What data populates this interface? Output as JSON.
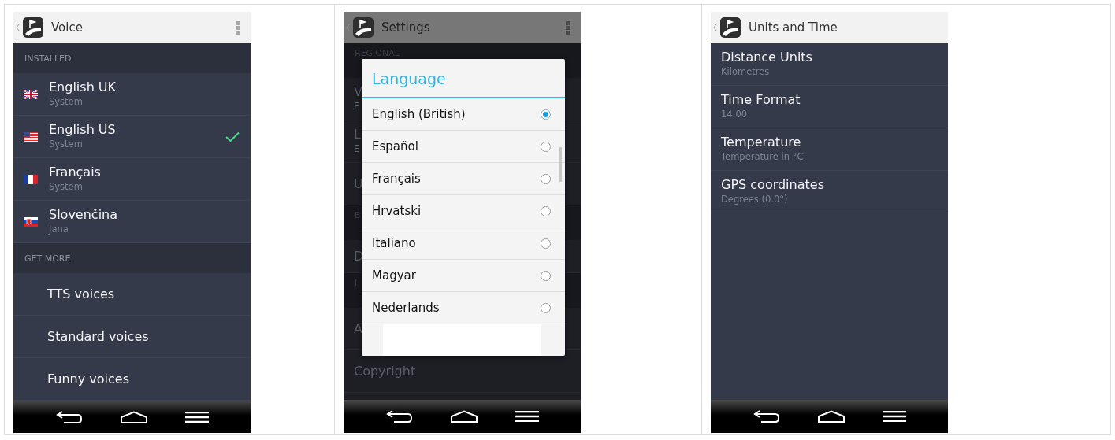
{
  "screens": [
    {
      "kind": "voice",
      "title": "Voice",
      "menu": true,
      "sections": [
        {
          "label": "INSTALLED",
          "items": [
            {
              "kind": "uk",
              "title": "English UK",
              "subtitle": "System",
              "selected": false
            },
            {
              "kind": "us",
              "title": "English US",
              "subtitle": "System",
              "selected": true
            },
            {
              "kind": "fr",
              "title": "Français",
              "subtitle": "System",
              "selected": false
            },
            {
              "kind": "sk",
              "title": "Slovenčina",
              "subtitle": "Jana",
              "selected": false
            }
          ]
        },
        {
          "label": "GET MORE",
          "items": [
            {
              "kind": "link",
              "title": "TTS voices"
            },
            {
              "kind": "link",
              "title": "Standard voices"
            },
            {
              "kind": "link",
              "title": "Funny voices"
            }
          ]
        }
      ]
    },
    {
      "kind": "dialog",
      "title": "Settings",
      "menu": true,
      "background": [
        {
          "kind": "section",
          "texts": [
            "REGIONAL"
          ]
        },
        {
          "kind": "item",
          "texts": [
            "V",
            "E"
          ]
        },
        {
          "kind": "item",
          "texts": [
            "L",
            "E"
          ]
        },
        {
          "kind": "item",
          "texts": [
            "U"
          ]
        },
        {
          "kind": "section",
          "texts": [
            "B"
          ]
        },
        {
          "kind": "short",
          "texts": [
            "D"
          ]
        },
        {
          "kind": "section",
          "texts": [
            "I"
          ]
        },
        {
          "kind": "item",
          "texts": [
            "A"
          ]
        },
        {
          "kind": "item",
          "texts": [
            "Copyright"
          ]
        }
      ],
      "dialog": {
        "title": "Language",
        "options": [
          {
            "label": "English (British)",
            "selected": true
          },
          {
            "label": "Español",
            "selected": false
          },
          {
            "label": "Français",
            "selected": false
          },
          {
            "label": "Hrvatski",
            "selected": false
          },
          {
            "label": "Italiano",
            "selected": false
          },
          {
            "label": "Magyar",
            "selected": false
          },
          {
            "label": "Nederlands",
            "selected": false
          }
        ]
      }
    },
    {
      "kind": "units",
      "title": "Units and Time",
      "menu": false,
      "items": [
        {
          "title": "Distance Units",
          "subtitle": "Kilometres"
        },
        {
          "title": "Time Format",
          "subtitle": "14:00"
        },
        {
          "title": "Temperature",
          "subtitle": "Temperature in °C"
        },
        {
          "title": "GPS coordinates",
          "subtitle": "Degrees (0.0°)"
        }
      ]
    }
  ]
}
